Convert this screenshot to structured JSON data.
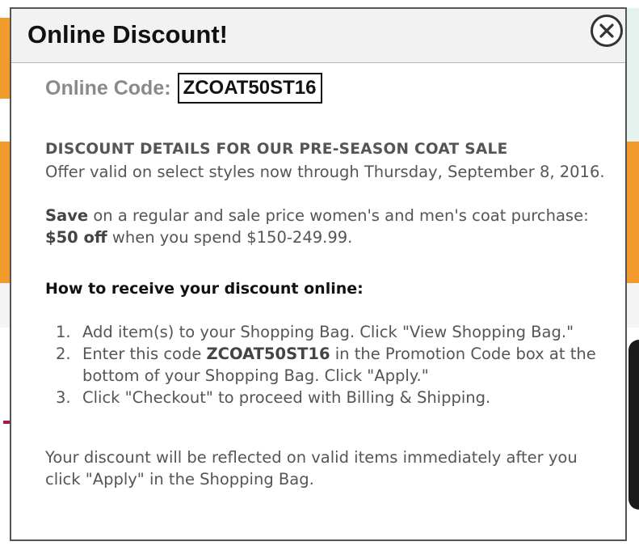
{
  "modal": {
    "title": "Online Discount!",
    "close_icon": "close-x-circle-icon",
    "code_label": "Online Code:",
    "code": "ZCOAT50ST16",
    "details_heading": "DISCOUNT DETAILS FOR OUR PRE-SEASON COAT SALE",
    "offer_text": "Offer valid on select styles now through Thursday, September 8, 2016.",
    "save_word": "Save",
    "save_text": " on a regular and sale price women's and men's coat purchase:",
    "amount_off": "$50 off",
    "amount_text": " when you spend $150-249.99.",
    "how_heading": "How to receive your discount online:",
    "steps": [
      {
        "num": "1.",
        "text": "Add item(s) to your Shopping Bag. Click \"View Shopping Bag.\""
      },
      {
        "num": "2.",
        "pre": "Enter this code ",
        "code": "ZCOAT50ST16",
        "post": " in the Promotion Code box at the bottom of your Shopping Bag. Click \"Apply.\""
      },
      {
        "num": "3.",
        "text": "Click \"Checkout\" to proceed with Billing & Shipping."
      }
    ],
    "footer_note": "Your discount will be reflected on valid items immediately after you click \"Apply\" in the Shopping Bag."
  },
  "colors": {
    "header_bg": "#f2f2f2",
    "modal_border": "#555555",
    "body_text": "#555555",
    "background_accent": "#f29b2c"
  }
}
